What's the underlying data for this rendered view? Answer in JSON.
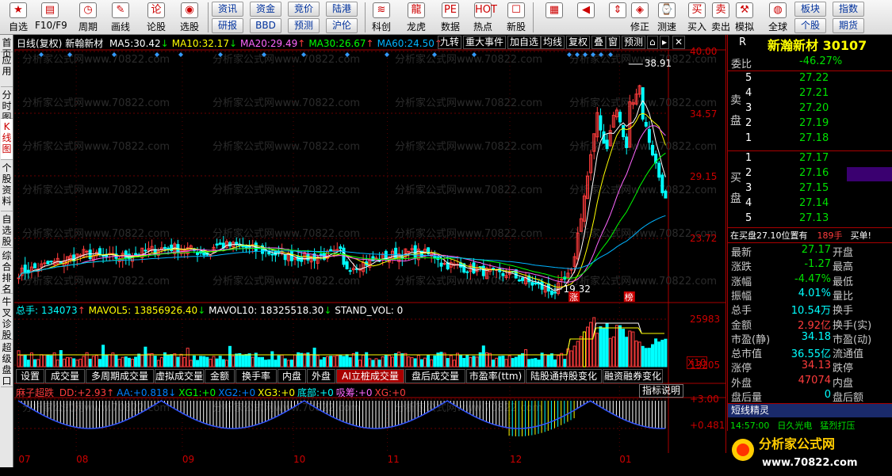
{
  "toolbar": {
    "buttons": [
      {
        "label": "自选",
        "icon": "star-icon",
        "x": 4
      },
      {
        "label": "F10/F9",
        "icon": "f10-icon",
        "x": 44
      },
      {
        "label": "周期",
        "icon": "clock-icon",
        "x": 92
      },
      {
        "label": "画线",
        "icon": "pencil-icon",
        "x": 133
      },
      {
        "label": "论股",
        "icon": "forum-icon",
        "x": 178
      },
      {
        "label": "选股",
        "icon": "select-icon",
        "x": 220
      }
    ],
    "mini": [
      [
        "资讯",
        "研报"
      ],
      [
        "资金",
        "BBD"
      ],
      [
        "竞价",
        "预测"
      ],
      [
        "陆港",
        "沪伦"
      ]
    ],
    "buttons2": [
      {
        "label": "科创",
        "icon": "kechuang-icon",
        "x": 462
      },
      {
        "label": "龙虎",
        "icon": "dragon-icon",
        "x": 506
      },
      {
        "label": "数据",
        "icon": "data-icon",
        "x": 549
      },
      {
        "label": "热点",
        "icon": "hot-icon",
        "x": 590
      },
      {
        "label": "新股",
        "icon": "newstock-icon",
        "x": 632
      }
    ],
    "buttons3": [
      {
        "label": "",
        "icon": "grid-icon",
        "x": 680
      },
      {
        "label": "",
        "icon": "back-arrow-icon",
        "x": 720
      },
      {
        "label": "",
        "icon": "up-down-icon",
        "x": 760
      },
      {
        "label": "修正",
        "icon": "edit-icon",
        "x": 788
      },
      {
        "label": "测速",
        "icon": "speed-icon",
        "x": 822
      },
      {
        "label": "买入",
        "icon": "buy-icon",
        "x": 860
      },
      {
        "label": "卖出",
        "icon": "sell-icon",
        "x": 890
      },
      {
        "label": "模拟",
        "icon": "hammer-icon",
        "x": 920
      },
      {
        "label": "全球",
        "icon": "globe-icon",
        "x": 962
      }
    ],
    "mini2": [
      [
        "板块",
        "个股"
      ],
      [
        "指数",
        "期货"
      ]
    ]
  },
  "sidetabs": [
    "首页",
    "应用",
    "分时图",
    "K线图",
    "个股资料",
    "自选股",
    "综合排名",
    "牛叉诊股",
    "超级盘口"
  ],
  "chart": {
    "info_label": "日线(复权)",
    "stock_name": "新翰新材",
    "ma": [
      {
        "name": "MA5:",
        "value": "30.42",
        "dir": "↓",
        "color": "#ffffff"
      },
      {
        "name": "MA10:",
        "value": "32.17",
        "dir": "↓",
        "color": "#ffff00"
      },
      {
        "name": "MA20:",
        "value": "29.49",
        "dir": "↑",
        "color": "#ff66ff"
      },
      {
        "name": "MA30:",
        "value": "26.67",
        "dir": "↑",
        "color": "#00ff00"
      },
      {
        "name": "MA60:",
        "value": "24.50",
        "dir": "↑",
        "color": "#00b4ff"
      }
    ],
    "right_tabs": [
      "九转",
      "重大事件",
      "加自选",
      "均线",
      "复权",
      "叠",
      "窗",
      "预测"
    ],
    "y_ticks": [
      "40.00",
      "34.57",
      "29.15",
      "23.72"
    ],
    "high_label": "38.91",
    "low_label": "19.32",
    "tag_zhang": "涨",
    "tag_bang": "榜",
    "watermark": "分析家公式网www.70822.com"
  },
  "volume": {
    "info_label": "总手:",
    "info_value": "134073",
    "mavol5_label": "MAVOL5:",
    "mavol5": "13856926.40",
    "mavol10_label": "MAVOL10:",
    "mavol10": "18325518.30",
    "stand_label": "STAND_VOL:",
    "stand": "0",
    "y_ticks": [
      "25983",
      "13205",
      "X10"
    ]
  },
  "tabs": [
    "设置",
    "成交量",
    "多周期成交量",
    "虚拟成交量",
    "金额",
    "换手率",
    "内盘",
    "外盘",
    "AI立桩成交量",
    "盘后成交量",
    "市盈率(ttm)",
    "陆股通持股变化",
    "融资融券变化"
  ],
  "indicator": {
    "name": "麻子超跌",
    "values": [
      {
        "text": "DD:",
        "val": "+2.93",
        "dir": "↑",
        "color": "#ff3c3c"
      },
      {
        "text": "AA:",
        "val": "+0.818",
        "dir": "↓",
        "color": "#0080ff"
      },
      {
        "text": "XG1:",
        "val": "+0",
        "dir": "",
        "color": "#00ff00"
      },
      {
        "text": "XG2:",
        "val": "+0",
        "dir": "",
        "color": "#0080ff"
      },
      {
        "text": "XG3:",
        "val": "+0",
        "dir": "",
        "color": "#ffff00"
      },
      {
        "text": "底部:",
        "val": "+0",
        "dir": "",
        "color": "#00ffff"
      },
      {
        "text": "吸筹:",
        "val": "+0",
        "dir": "",
        "color": "#ff66ff"
      },
      {
        "text": "XG:",
        "val": "+0",
        "dir": "",
        "color": "#ff3c3c"
      }
    ],
    "button": "指标说明",
    "y_ticks": [
      "+3.00",
      "+0.481"
    ]
  },
  "xaxis": [
    {
      "label": "07",
      "pos": 0.006
    },
    {
      "label": "08",
      "pos": 0.087
    },
    {
      "label": "09",
      "pos": 0.236
    },
    {
      "label": "10",
      "pos": 0.392
    },
    {
      "label": "11",
      "pos": 0.524
    },
    {
      "label": "12",
      "pos": 0.696
    },
    {
      "label": "01",
      "pos": 0.85
    }
  ],
  "quote": {
    "code_r": "R",
    "title": "新瀚新材 30107",
    "weibi_label": "委比",
    "weibi": "-46.27%",
    "sell_label": "卖盘",
    "buy_label": "买盘",
    "asks": [
      [
        "5",
        "27.22"
      ],
      [
        "4",
        "27.21"
      ],
      [
        "3",
        "27.20"
      ],
      [
        "2",
        "27.19"
      ],
      [
        "1",
        "27.18"
      ]
    ],
    "bids": [
      [
        "1",
        "27.17"
      ],
      [
        "2",
        "27.16"
      ],
      [
        "3",
        "27.15"
      ],
      [
        "4",
        "27.14"
      ],
      [
        "5",
        "27.13"
      ]
    ],
    "notice": "在买盘27.10位置有",
    "notice_qty": "189手",
    "notice_tag": "买单!",
    "stats": [
      [
        "最新",
        "27.17",
        "开盘",
        ""
      ],
      [
        "涨跌",
        "-1.27",
        "最高",
        ""
      ],
      [
        "涨幅",
        "-4.47%",
        "最低",
        ""
      ],
      [
        "振幅",
        "4.01%",
        "量比",
        ""
      ],
      [
        "总手",
        "10.54万",
        "换手",
        ""
      ],
      [
        "金额",
        "2.92亿",
        "换手(实)",
        ""
      ],
      [
        "市盈(静)",
        "34.18",
        "市盈(动)",
        ""
      ],
      [
        "总市值",
        "36.55亿",
        "流通值",
        ""
      ],
      [
        "涨停",
        "34.13",
        "跌停",
        ""
      ],
      [
        "外盘",
        "47074",
        "内盘",
        ""
      ],
      [
        "盘后量",
        "0",
        "盘后额",
        ""
      ]
    ],
    "short_title": "短线精灵",
    "short_time": "14:57:00",
    "short_name": "日久光电",
    "short_event": "猛烈打压",
    "logo_text": "分析家公式网",
    "logo_url": "www.70822.com"
  },
  "chart_data": {
    "type": "candlestick",
    "ylim": [
      19.32,
      40.0
    ],
    "high": 38.91,
    "low": 19.32
  }
}
